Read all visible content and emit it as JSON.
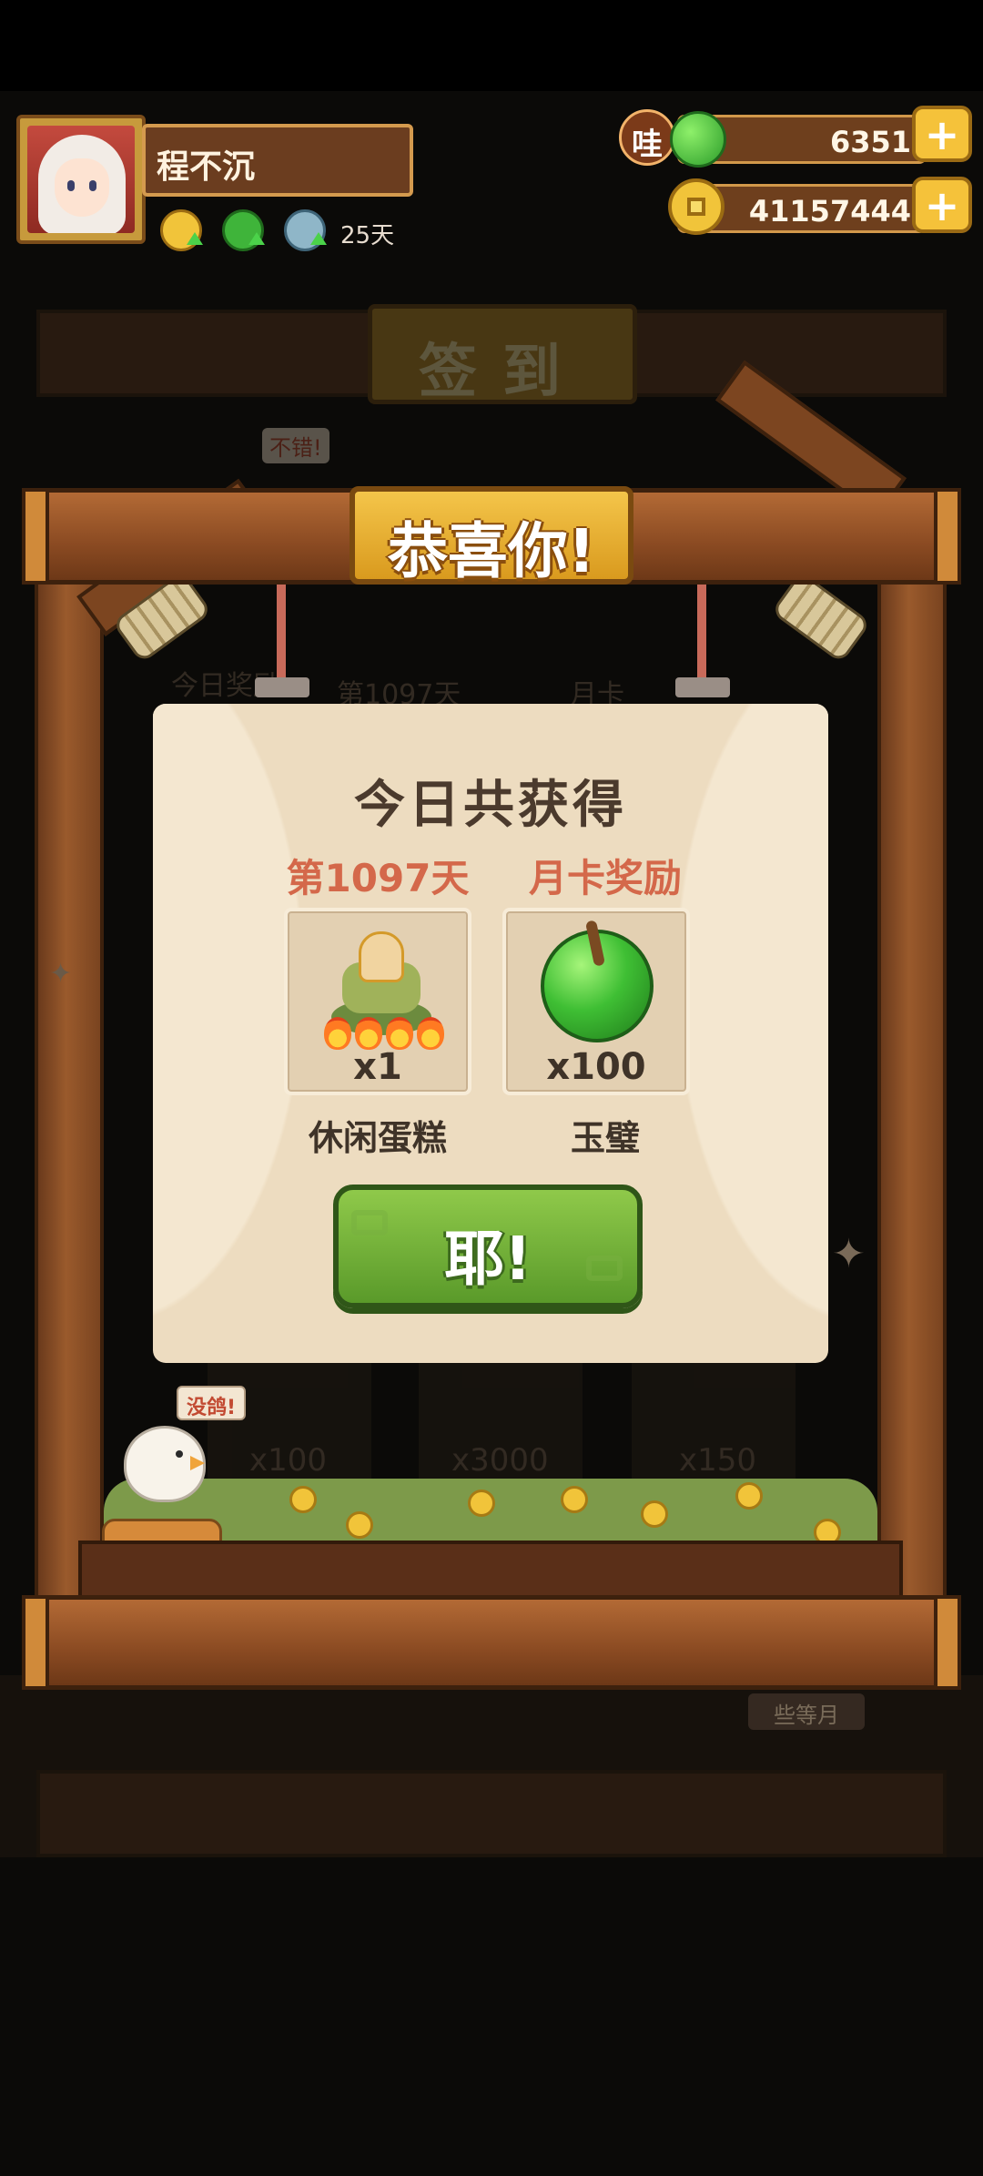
{
  "player": {
    "name": "程不沉",
    "buff_days": "25天"
  },
  "resources": {
    "jade_badge": "哇",
    "jade_amount": "6351",
    "coin_amount": "41157444",
    "add_symbol": "+"
  },
  "background": {
    "plaque": "签到",
    "chat_top": "不错!",
    "chat_bottom": "没鸽!",
    "tab_today": "今日奖励",
    "tab_day": "第1097天",
    "tab_card": "月卡",
    "slot_1_qty": "x100",
    "slot_2_qty": "x3000",
    "slot_3_qty": "x150",
    "sign": "些等月"
  },
  "popup": {
    "banner": "恭喜你!",
    "title": "今日共获得",
    "rewards": [
      {
        "header": "第1097天",
        "quantity": "x1",
        "name": "休闲蛋糕",
        "icon": "cake-icon"
      },
      {
        "header": "月卡奖励",
        "quantity": "x100",
        "name": "玉璧",
        "icon": "jade-disc-icon"
      }
    ],
    "confirm_label": "耶!"
  },
  "colors": {
    "reward_header": "#d4684a",
    "confirm_green": "#6fb03a",
    "wood": "#8a4a22",
    "gold": "#f1c43a"
  }
}
